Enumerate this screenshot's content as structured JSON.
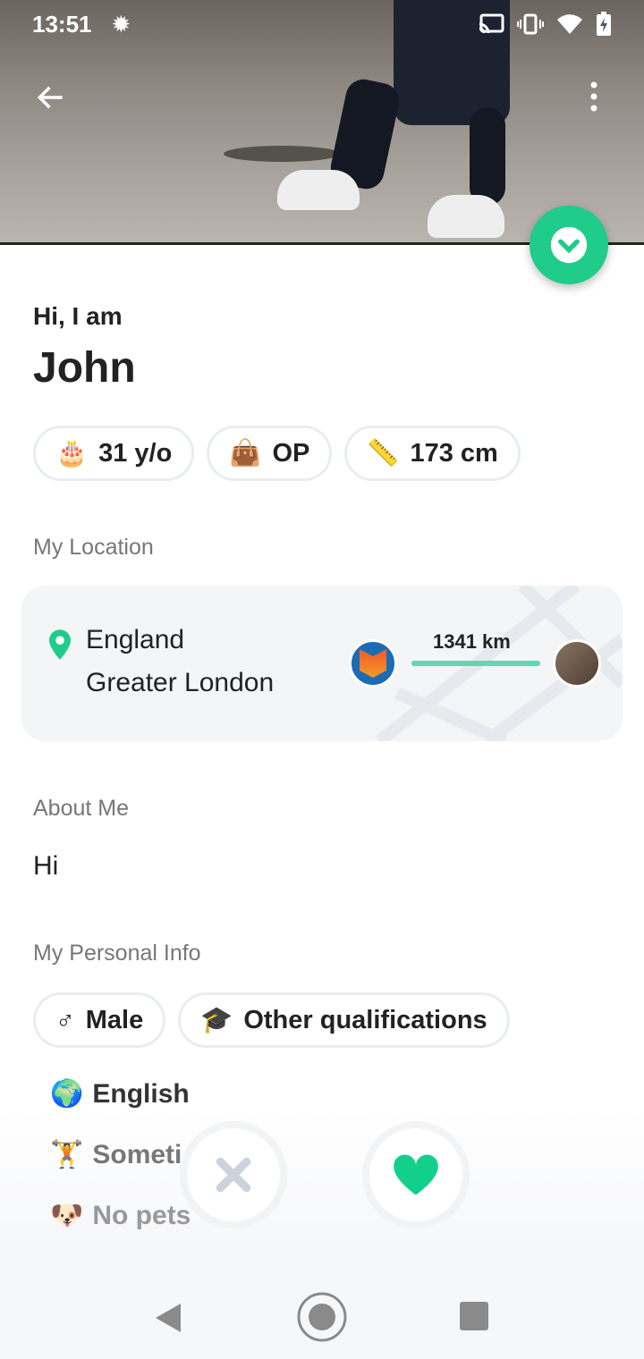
{
  "status_bar": {
    "time": "13:51",
    "icons": [
      "brightness-icon",
      "cast-icon",
      "vibrate-icon",
      "wifi-icon",
      "battery-charging-icon"
    ]
  },
  "header": {
    "back_icon": "arrow-left-icon",
    "menu_icon": "more-vertical-icon",
    "collapse_icon": "chevron-down-icon"
  },
  "profile": {
    "greeting": "Hi, I am",
    "name": "John",
    "chips": [
      {
        "icon": "cake-icon",
        "label": "31 y/o"
      },
      {
        "icon": "bag-icon",
        "label": "OP"
      },
      {
        "icon": "ruler-icon",
        "label": "173 cm"
      }
    ]
  },
  "location": {
    "title": "My Location",
    "country": "England",
    "region": "Greater London",
    "distance": "1341 km"
  },
  "about": {
    "title": "About Me",
    "text": "Hi"
  },
  "personal": {
    "title": "My Personal Info",
    "chips": [
      {
        "icon": "male-icon",
        "label": "Male"
      },
      {
        "icon": "graduation-cap-icon",
        "label": "Other qualifications"
      }
    ],
    "items": [
      {
        "icon": "globe-icon",
        "label": "English"
      },
      {
        "icon": "dumbbell-icon",
        "label": "Someti"
      },
      {
        "icon": "dog-icon",
        "label": "No pets"
      }
    ]
  },
  "actions": {
    "dislike_icon": "close-icon",
    "like_icon": "heart-icon"
  },
  "colors": {
    "accent": "#1fcc8a",
    "dislike": "#cdd3dc"
  }
}
